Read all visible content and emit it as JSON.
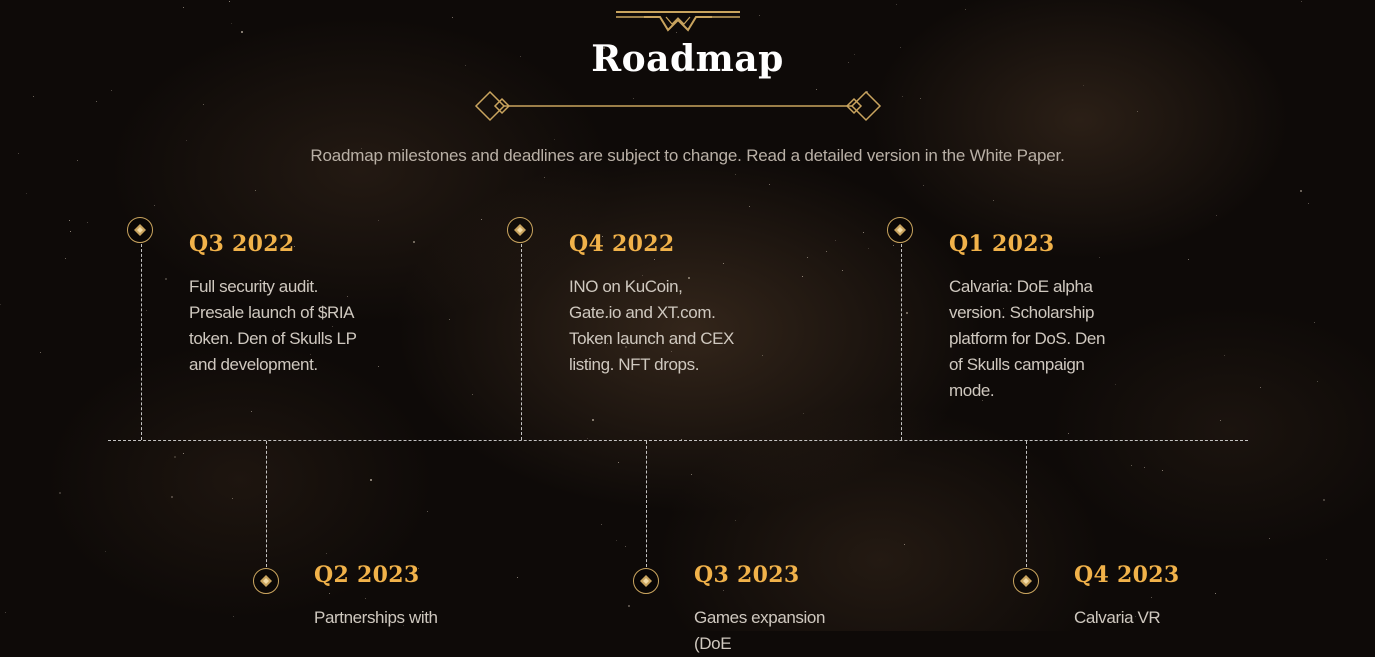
{
  "header": {
    "title": "Roadmap",
    "subtitle": "Roadmap milestones and deadlines are subject to change. Read a detailed version in the White Paper."
  },
  "colors": {
    "accent_gold": "#f1b24a",
    "ornament_gold": "#c9a45e",
    "background": "#0e0a08",
    "text_muted": "#cfc8bf"
  },
  "milestones": [
    {
      "period": "Q3 2022",
      "description": "Full security audit. Presale launch of $RIA token. Den of Skulls LP and development."
    },
    {
      "period": "Q4 2022",
      "description": "INO on KuCoin, Gate.io and XT.com. Token launch and CEX listing. NFT drops."
    },
    {
      "period": "Q1 2023",
      "description": "Calvaria: DoE alpha version. Scholarship platform for DoS. Den of Skulls campaign mode."
    },
    {
      "period": "Q2 2023",
      "description": "Partnerships with"
    },
    {
      "period": "Q3 2023",
      "description": "Games expansion (DoE"
    },
    {
      "period": "Q4 2023",
      "description": "Calvaria VR"
    }
  ],
  "icons": {
    "top_ornament": "crown-ornament-icon",
    "divider": "diamond-divider-icon",
    "marker": "diamond-marker-icon"
  }
}
